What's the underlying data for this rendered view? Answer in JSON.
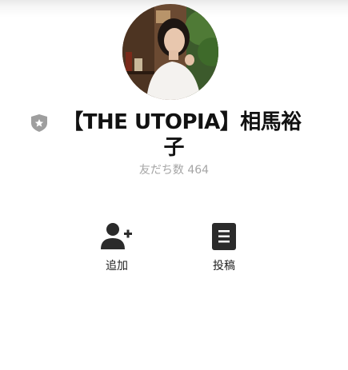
{
  "profile": {
    "name_line1": "【THE UTOPIA】相馬裕",
    "name_line2": "子",
    "friends_label": "友だち数",
    "friends_count": "464",
    "badge_icon": "shield-star-icon"
  },
  "actions": [
    {
      "label": "追加",
      "icon": "add-friend-icon"
    },
    {
      "label": "投稿",
      "icon": "posts-icon"
    }
  ],
  "colors": {
    "badge": "#9e9e9e",
    "icon": "#2b2b2b",
    "muted_text": "#a5a5a5"
  }
}
